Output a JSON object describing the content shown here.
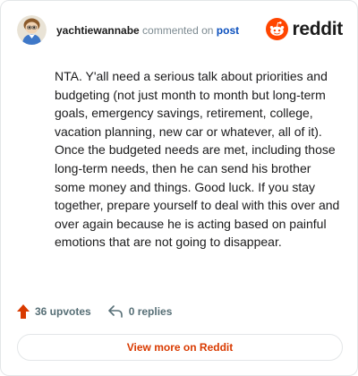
{
  "header": {
    "username": "yachtiewannabe",
    "action_text": "commented on",
    "post_link": "post",
    "brand_name": "reddit"
  },
  "comment": {
    "body": "NTA. Y'all need a serious talk about priorities and budgeting (not just month to month but long-term goals, emergency savings, retirement, college, vacation planning, new car or whatever, all of it). Once the budgeted needs are met, including those long-term needs, then he can send his brother some money and things. Good luck. If you stay together, prepare yourself to deal with this over and over again because he is acting based on painful emotions that are not going to disappear."
  },
  "actions": {
    "upvotes_label": "36 upvotes",
    "replies_label": "0 replies"
  },
  "footer": {
    "view_more_label": "View more on Reddit"
  },
  "colors": {
    "brand": "#ff4500",
    "upvote": "#d93a00",
    "link": "#0a4fbd",
    "view_more_text": "#d93a00",
    "border": "#e3e6e8"
  },
  "icons": {
    "avatar": "snoo-avatar-icon",
    "brand": "reddit-logo-icon",
    "upvote": "upvote-arrow-icon",
    "reply": "reply-arrow-icon"
  }
}
